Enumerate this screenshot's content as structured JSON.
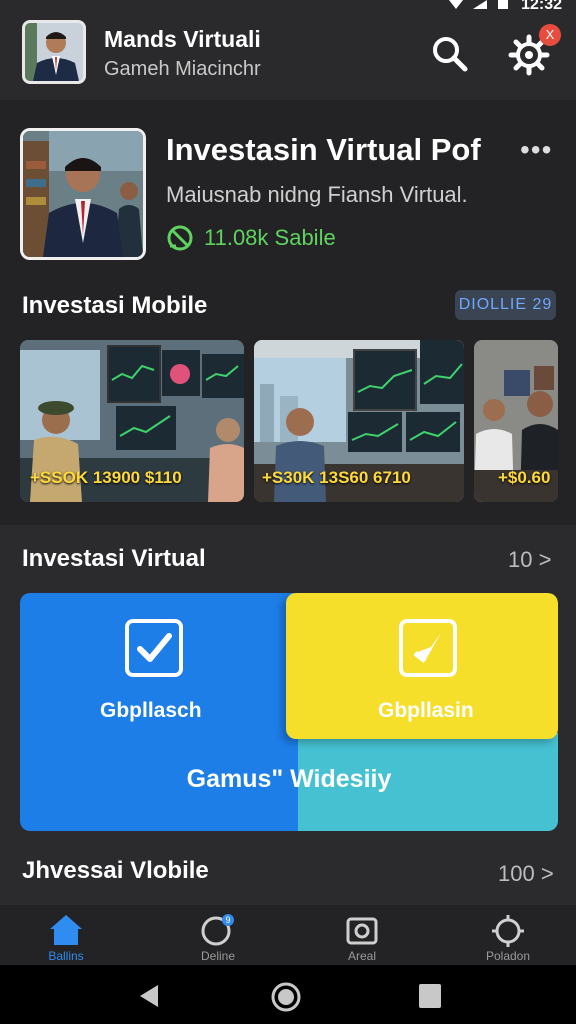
{
  "status_bar": {
    "time": "12:32"
  },
  "header": {
    "title": "Mands Virtuali",
    "subtitle": "Gameh Miacinchr",
    "notification_count": "X"
  },
  "profile": {
    "title": "Investasin Virtual  Pof",
    "description": "Maiusnab nidng Fiansh Virtual.",
    "stat": "11.08k Sabile"
  },
  "section_mobile": {
    "title": "Investasi Mobile",
    "badge": "DIOLLIE 29",
    "items": [
      {
        "price": "+SSOK 13900 $110"
      },
      {
        "price": "+S30K 13S60 6710"
      },
      {
        "price": "+$0.60"
      }
    ]
  },
  "section_virtual": {
    "title": "Investasi Virtual",
    "count": "10 >",
    "tiles": {
      "blue_label": "Gbpllasch",
      "yellow_label": "Gbpllasin",
      "wide_label": "Gamus\" Widesiiy"
    }
  },
  "section_bottom": {
    "title": "Jhvessai Vlobile",
    "count": "100 >"
  },
  "bottom_nav": {
    "items": [
      {
        "label": "Ballins"
      },
      {
        "label": "Deline"
      },
      {
        "label": "Areal"
      },
      {
        "label": "Poladon"
      }
    ],
    "badge": "9"
  },
  "colors": {
    "accent_blue": "#1d7ee8",
    "accent_yellow": "#f5df2a",
    "accent_cyan": "#45c1d2",
    "stat_green": "#5fd35f",
    "nav_active": "#2f8cf0"
  }
}
